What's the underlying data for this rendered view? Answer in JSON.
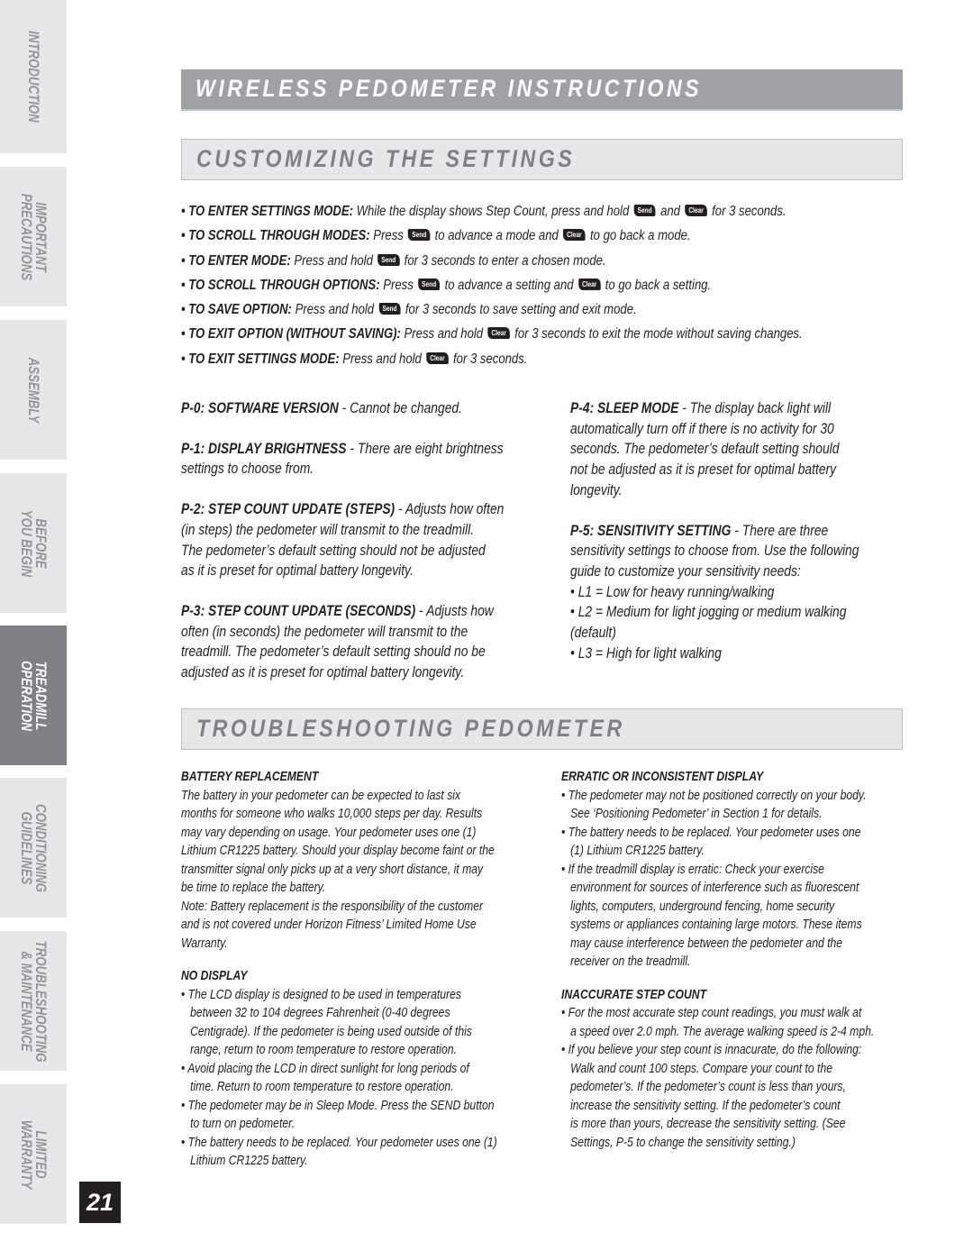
{
  "sidebar": {
    "tabs": [
      {
        "lines": [
          "INTRODUCTION"
        ],
        "active": false
      },
      {
        "lines": [
          "IMPORTANT",
          "PRECAUTIONS"
        ],
        "active": false
      },
      {
        "lines": [
          "ASSEMBLY"
        ],
        "active": false
      },
      {
        "lines": [
          "BEFORE",
          "YOU BEGIN"
        ],
        "active": false
      },
      {
        "lines": [
          "TREADMILL",
          "OPERATION"
        ],
        "active": true
      },
      {
        "lines": [
          "CONDITIONING",
          "GUIDELINES"
        ],
        "active": false
      },
      {
        "lines": [
          "TROUBLESHOOTING",
          "& MAINTENANCE"
        ],
        "active": false
      },
      {
        "lines": [
          "LIMITED",
          "WARRANTY"
        ],
        "active": false
      }
    ],
    "page_number": "21"
  },
  "header": {
    "title": "WIRELESS PEDOMETER INSTRUCTIONS",
    "section1": "CUSTOMIZING THE SETTINGS",
    "section2": "TROUBLESHOOTING PEDOMETER"
  },
  "keys": {
    "send": "Send",
    "clear": "Clear"
  },
  "instructions": [
    {
      "label": "• TO ENTER SETTINGS MODE:",
      "parts": [
        " While the display shows Step Count, press and hold ",
        "{send}",
        " and ",
        "{clear}",
        " for 3 seconds."
      ]
    },
    {
      "label": "• TO SCROLL THROUGH MODES:",
      "parts": [
        " Press ",
        "{send}",
        " to advance a mode and ",
        "{clear}",
        " to go back a mode."
      ]
    },
    {
      "label": "• TO ENTER MODE:",
      "parts": [
        " Press and hold ",
        "{send}",
        " for 3 seconds to enter a chosen mode."
      ]
    },
    {
      "label": "• TO SCROLL THROUGH OPTIONS:",
      "parts": [
        " Press ",
        "{send}",
        " to advance a setting and ",
        "{clear}",
        " to go back a setting."
      ]
    },
    {
      "label": "• TO SAVE OPTION:",
      "parts": [
        " Press and hold ",
        "{send}",
        " for 3 seconds to save setting and exit mode."
      ]
    },
    {
      "label": "• TO EXIT OPTION (WITHOUT SAVING):",
      "parts": [
        " Press and hold ",
        "{clear}",
        " for 3 seconds to exit the mode without saving changes."
      ]
    },
    {
      "label": "• TO EXIT SETTINGS MODE:",
      "parts": [
        " Press and hold ",
        "{clear}",
        " for 3 seconds."
      ]
    }
  ],
  "settings_left": [
    {
      "title": "P-0: SOFTWARE VERSION",
      "lines": [
        " - Cannot be changed."
      ]
    },
    {
      "title": "P-1: DISPLAY BRIGHTNESS",
      "lines": [
        " - There are eight brightness",
        "settings to choose from."
      ]
    },
    {
      "title": "P-2: STEP COUNT UPDATE (STEPS)",
      "lines": [
        " - Adjusts how often",
        "(in steps) the pedometer will transmit to the treadmill.",
        "The pedometer’s default setting should not be adjusted",
        "as it is preset for optimal battery longevity."
      ]
    },
    {
      "title": "P-3: STEP COUNT UPDATE (SECONDS)",
      "lines": [
        " - Adjusts how",
        "often (in seconds) the pedometer will transmit to the",
        "treadmill. The pedometer’s default setting should no be",
        "adjusted as it is preset for optimal battery longevity."
      ]
    }
  ],
  "settings_right": [
    {
      "title": "P-4: SLEEP MODE",
      "lines": [
        " - The display back light will",
        "automatically turn off if there is no activity for 30",
        "seconds. The pedometer’s default setting should",
        "not be adjusted as it is preset for optimal battery",
        "longevity."
      ]
    },
    {
      "title": "P-5: SENSITIVITY SETTING",
      "lines": [
        " - There are three",
        "sensitivity settings to choose from. Use the following",
        "guide to customize your sensitivity needs:",
        "• L1 = Low for heavy running/walking",
        "• L2 = Medium for light jogging or medium walking",
        "(default)",
        "• L3 = High for light walking"
      ]
    }
  ],
  "troubleshooting_left": [
    {
      "heading": "BATTERY REPLACEMENT",
      "lines": [
        {
          "t": "The battery in your pedometer can be expected to last six",
          "i": false
        },
        {
          "t": "months for someone who walks 10,000 steps per day.  Results",
          "i": false
        },
        {
          "t": "may vary depending on usage.  Your pedometer uses one (1)",
          "i": false
        },
        {
          "t": "Lithium CR1225 battery.  Should your display become faint or the",
          "i": false
        },
        {
          "t": "transmitter signal only picks up at a very short distance, it may",
          "i": false
        },
        {
          "t": "be time to replace the battery.",
          "i": false
        },
        {
          "t": "Note: Battery replacement is the responsibility of the customer",
          "i": false
        },
        {
          "t": "and is not covered under Horizon Fitness’ Limited Home Use",
          "i": false
        },
        {
          "t": "Warranty.",
          "i": false
        }
      ]
    },
    {
      "heading": "NO DISPLAY",
      "lines": [
        {
          "t": "• The LCD display is designed to be used in temperatures",
          "i": false
        },
        {
          "t": "between 32 to 104 degrees Fahrenheit (0-40 degrees",
          "i": true
        },
        {
          "t": "Centigrade).  If the pedometer is being used outside of this",
          "i": true
        },
        {
          "t": "range, return to room temperature to restore operation.",
          "i": true
        },
        {
          "t": "• Avoid placing the LCD in direct sunlight for long periods of",
          "i": false
        },
        {
          "t": "time.  Return to room temperature to restore operation.",
          "i": true
        },
        {
          "t": "• The pedometer may be in Sleep Mode.  Press the SEND button",
          "i": false
        },
        {
          "t": "to turn on pedometer.",
          "i": true
        },
        {
          "t": "• The battery needs to be replaced.  Your pedometer uses one (1)",
          "i": false
        },
        {
          "t": "Lithium CR1225 battery.",
          "i": true
        }
      ]
    }
  ],
  "troubleshooting_right": [
    {
      "heading": "ERRATIC OR INCONSISTENT DISPLAY",
      "lines": [
        {
          "t": "• The pedometer may not be positioned correctly on your body.",
          "i": false
        },
        {
          "t": "See ‘Positioning Pedometer’ in Section 1 for details.",
          "i": true
        },
        {
          "t": "• The battery needs to be replaced.  Your pedometer uses one",
          "i": false
        },
        {
          "t": "(1) Lithium CR1225 battery.",
          "i": true
        },
        {
          "t": "• If the treadmill display is erratic: Check your exercise",
          "i": false
        },
        {
          "t": "environment for sources of interference such as fluorescent",
          "i": true
        },
        {
          "t": "lights, computers, underground fencing, home security",
          "i": true
        },
        {
          "t": "systems or appliances containing large motors. These items",
          "i": true
        },
        {
          "t": "may cause interference between the pedometer and the",
          "i": true
        },
        {
          "t": "receiver on the treadmill.",
          "i": true
        }
      ]
    },
    {
      "heading": "INACCURATE STEP COUNT",
      "lines": [
        {
          "t": "• For the most accurate step count readings, you must walk at",
          "i": false
        },
        {
          "t": "a speed over 2.0 mph. The average walking speed is 2-4 mph.",
          "i": true
        },
        {
          "t": "• If you believe your step count is innacurate, do the following:",
          "i": false
        },
        {
          "t": "Walk and count 100 steps. Compare your count to the",
          "i": true
        },
        {
          "t": "pedometer’s. If the pedometer’s count is less than yours,",
          "i": true
        },
        {
          "t": "increase the sensitivity setting. If the pedometer’s count",
          "i": true
        },
        {
          "t": "is more than yours, decrease the sensitivity setting. (See",
          "i": true
        },
        {
          "t": "Settings, P-5 to change the sensitivity setting.)",
          "i": true
        }
      ]
    }
  ]
}
